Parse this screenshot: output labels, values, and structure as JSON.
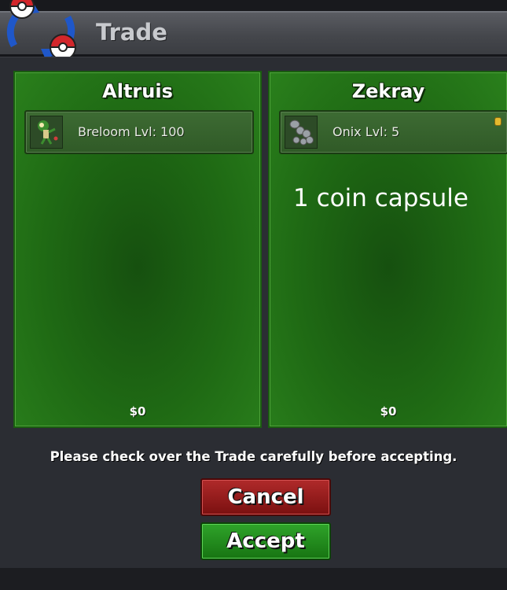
{
  "window": {
    "title": "Trade"
  },
  "left_player": {
    "name": "Altruis",
    "slots": [
      {
        "label": "Breloom  Lvl: 100",
        "icon": "breloom-sprite-icon"
      }
    ],
    "money": "$0"
  },
  "right_player": {
    "name": "Zekray",
    "slots": [
      {
        "label": "Onix  Lvl: 5",
        "icon": "onix-sprite-icon"
      }
    ],
    "note": "1 coin capsule",
    "money": "$0"
  },
  "footer": {
    "warning": "Please check over the Trade carefully before accepting.",
    "cancel_label": "Cancel",
    "accept_label": "Accept"
  },
  "colors": {
    "panel_green": "#1f6a14",
    "cancel_red": "#9a1d1d",
    "accept_green": "#239a1e",
    "titlebar": "#4a4c51"
  }
}
